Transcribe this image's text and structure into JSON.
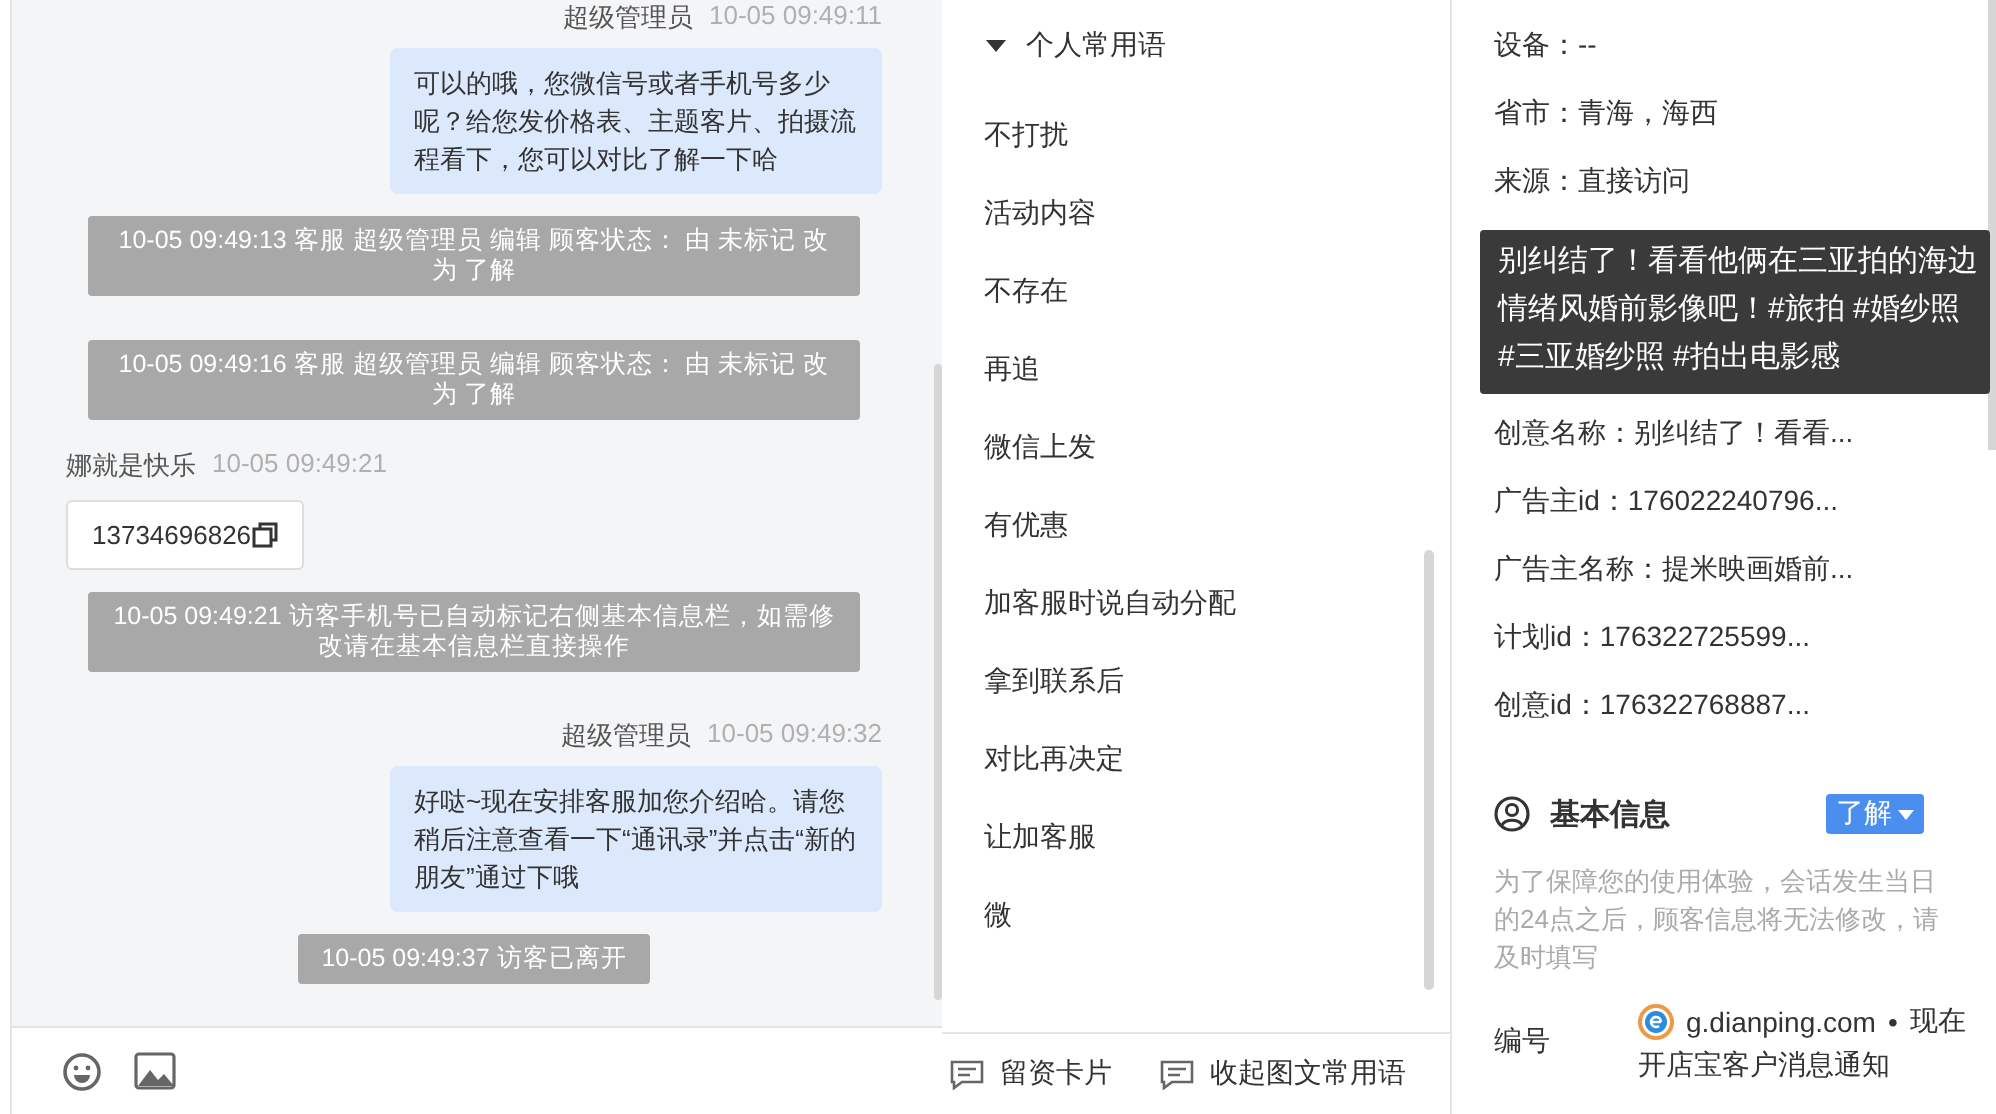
{
  "chat": {
    "messages": [
      {
        "kind": "agent",
        "name": "超级管理员",
        "time": "10-05 09:49:11",
        "text": "可以的哦，您微信号或者手机号多少呢？给您发价格表、主题客片、拍摄流程看下，您可以对比了解一下哈"
      },
      {
        "kind": "system",
        "text": "10-05 09:49:13 客服 超级管理员 编辑 顾客状态： 由 未标记 改为 了解"
      },
      {
        "kind": "system",
        "text": "10-05 09:49:16 客服 超级管理员 编辑 顾客状态： 由 未标记 改为 了解"
      },
      {
        "kind": "visitor",
        "name": "娜就是快乐",
        "time": "10-05 09:49:21",
        "text": "13734696826"
      },
      {
        "kind": "system",
        "text": "10-05 09:49:21 访客手机号已自动标记右侧基本信息栏，如需修改请在基本信息栏直接操作"
      },
      {
        "kind": "agent",
        "name": "超级管理员",
        "time": "10-05 09:49:32",
        "text": "好哒~现在安排客服加您介绍哈。请您稍后注意查看一下“通讯录”并点击“新的朋友”通过下哦"
      },
      {
        "kind": "system",
        "text": "10-05 09:49:37 访客已离开"
      }
    ]
  },
  "phrases": {
    "title": "个人常用语",
    "expanded": true,
    "items": [
      "不打扰",
      "活动内容",
      "不存在",
      "再追",
      "微信上发",
      "有优惠",
      "加客服时说自动分配",
      "拿到联系后",
      "对比再决定",
      "让加客服",
      "微"
    ],
    "actions": [
      "留资卡片",
      "收起图文常用语"
    ]
  },
  "info": {
    "rows_top": [
      "设备：--",
      "省市：青海，海西",
      "来源：直接访问"
    ],
    "tooltip": "别纠结了！看看他俩在三亚拍的海边情绪风婚前影像吧！#旅拍 #婚纱照 #三亚婚纱照 #拍出电影感",
    "rows": [
      "创意名称：别纠结了！看看...",
      "广告主id：176022240796...",
      "广告主名称：提米映画婚前...",
      "计划id：176322725599...",
      "创意id：176322768887..."
    ],
    "basic": {
      "title": "基本信息",
      "status": "了解",
      "notice": "为了保障您的使用体验，会话发生当日的24点之后，顾客信息将无法修改，请及时填写",
      "field_label": "编号"
    }
  },
  "notification": {
    "source": "g.dianping.com",
    "separator": "•",
    "time": "现在",
    "title": "开店宝客户消息通知"
  }
}
